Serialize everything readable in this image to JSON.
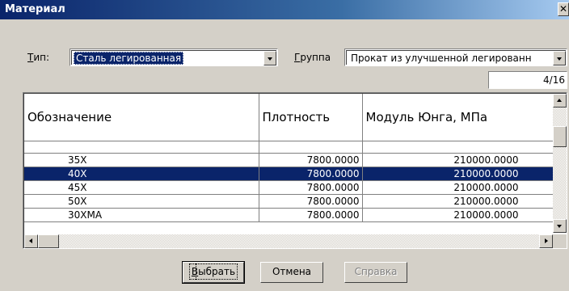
{
  "window": {
    "title": "Материал"
  },
  "type_field": {
    "label_underlined": "Т",
    "label_rest": "ип:",
    "value": "Сталь легированная"
  },
  "group_field": {
    "label_underlined": "Г",
    "label_rest": "руппа",
    "value": "Прокат из улучшенной легированн"
  },
  "counter": {
    "value": "4/16"
  },
  "table": {
    "columns": [
      "Обозначение",
      "Плотность",
      "Модуль Юнга, МПа"
    ],
    "rows": [
      {
        "code": "35Х",
        "density": "7800.0000",
        "modulus": "210000.0000",
        "selected": false
      },
      {
        "code": "40Х",
        "density": "7800.0000",
        "modulus": "210000.0000",
        "selected": true
      },
      {
        "code": "45Х",
        "density": "7800.0000",
        "modulus": "210000.0000",
        "selected": false
      },
      {
        "code": "50Х",
        "density": "7800.0000",
        "modulus": "210000.0000",
        "selected": false
      },
      {
        "code": "30ХМА",
        "density": "7800.0000",
        "modulus": "210000.0000",
        "selected": false
      }
    ]
  },
  "buttons": {
    "select_underlined": "В",
    "select_rest": "ыбрать",
    "cancel": "Отмена",
    "help": "Справка"
  },
  "colors": {
    "selection": "#0a246a",
    "face": "#d4d0c8"
  }
}
